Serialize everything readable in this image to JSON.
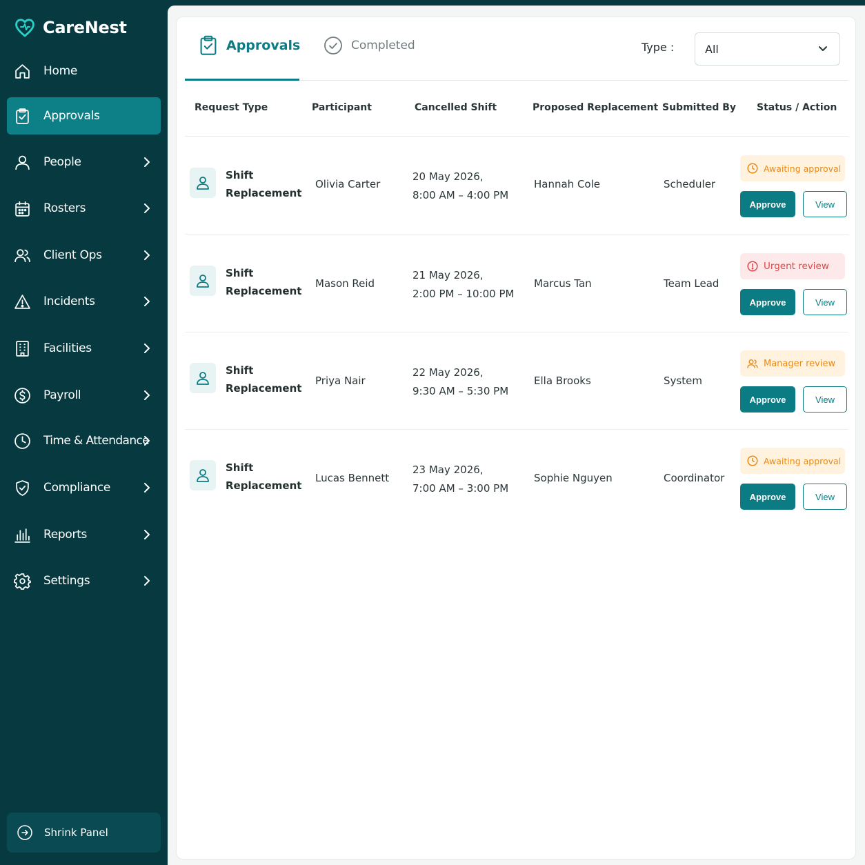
{
  "brand": {
    "name": "CareNest",
    "accent": "#0b7c84",
    "sidebar_bg": "#063a40"
  },
  "sidebar": {
    "items": [
      {
        "label": "Home",
        "icon": "home-icon",
        "active": false,
        "has_chevron": false
      },
      {
        "label": "Approvals",
        "icon": "clipboard-check-icon",
        "active": true,
        "has_chevron": false
      },
      {
        "label": "People",
        "icon": "user-icon",
        "active": false,
        "has_chevron": true
      },
      {
        "label": "Rosters",
        "icon": "calendar-icon",
        "active": false,
        "has_chevron": true
      },
      {
        "label": "Client Ops",
        "icon": "users-icon",
        "active": false,
        "has_chevron": true
      },
      {
        "label": "Incidents",
        "icon": "warning-triangle-icon",
        "active": false,
        "has_chevron": true
      },
      {
        "label": "Facilities",
        "icon": "building-icon",
        "active": false,
        "has_chevron": true
      },
      {
        "label": "Payroll",
        "icon": "dollar-circle-icon",
        "active": false,
        "has_chevron": true
      },
      {
        "label": "Time & Attendance",
        "icon": "clock-icon",
        "active": false,
        "has_chevron": true
      },
      {
        "label": "Compliance",
        "icon": "shield-check-icon",
        "active": false,
        "has_chevron": true
      },
      {
        "label": "Reports",
        "icon": "bar-chart-icon",
        "active": false,
        "has_chevron": true
      },
      {
        "label": "Settings",
        "icon": "gear-icon",
        "active": false,
        "has_chevron": true
      }
    ],
    "shrink_label": "Shrink Panel"
  },
  "tabs": {
    "approvals": "Approvals",
    "completed": "Completed"
  },
  "filter": {
    "type_label": "Type :",
    "type_value": "All"
  },
  "table": {
    "headers": {
      "request_type": "Request Type",
      "participant": "Participant",
      "cancelled_shift": "Cancelled Shift",
      "proposed_replacement": "Proposed Replacement",
      "submitted_by": "Submitted By",
      "status_action": "Status / Action"
    },
    "rows": [
      {
        "request_type_line1": "Shift",
        "request_type_line2": "Replacement",
        "participant": "Olivia Carter",
        "shift_date": "20 May 2026,",
        "shift_time": "8:00 AM – 4:00 PM",
        "replacement": "Hannah Cole",
        "submitted_by": "Scheduler",
        "status": "Awaiting approval",
        "status_kind": "awaiting",
        "approve": "Approve",
        "view": "View"
      },
      {
        "request_type_line1": "Shift",
        "request_type_line2": "Replacement",
        "participant": "Mason Reid",
        "shift_date": "21 May 2026,",
        "shift_time": "2:00 PM – 10:00 PM",
        "replacement": "Marcus Tan",
        "submitted_by": "Team Lead",
        "status": "Urgent review",
        "status_kind": "urgent",
        "approve": "Approve",
        "view": "View"
      },
      {
        "request_type_line1": "Shift",
        "request_type_line2": "Replacement",
        "participant": "Priya Nair",
        "shift_date": "22 May 2026,",
        "shift_time": "9:30 AM – 5:30 PM",
        "replacement": "Ella Brooks",
        "submitted_by": "System",
        "status": "Manager review",
        "status_kind": "manager",
        "approve": "Approve",
        "view": "View"
      },
      {
        "request_type_line1": "Shift",
        "request_type_line2": "Replacement",
        "participant": "Lucas Bennett",
        "shift_date": "23 May 2026,",
        "shift_time": "7:00 AM – 3:00 PM",
        "replacement": "Sophie Nguyen",
        "submitted_by": "Coordinator",
        "status": "Awaiting approval",
        "status_kind": "awaiting",
        "approve": "Approve",
        "view": "View"
      }
    ]
  }
}
